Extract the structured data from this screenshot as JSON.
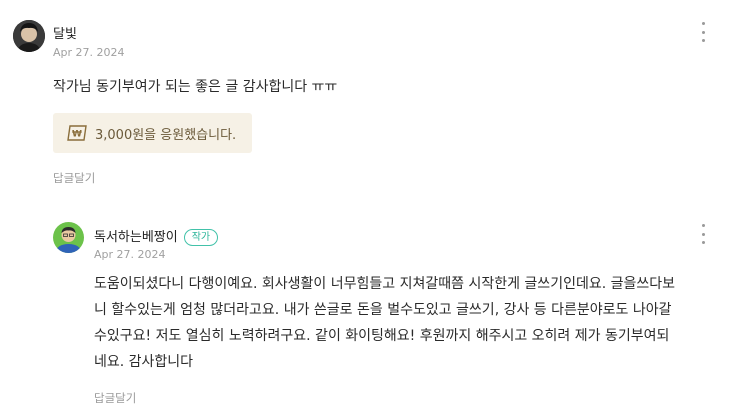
{
  "comment": {
    "username": "달빛",
    "date": "Apr 27. 2024",
    "text": "작가님 동기부여가 되는 좋은 글 감사합니다 ㅠㅠ",
    "support_message": "3,000원을 응원했습니다.",
    "reply_label": "답글달기",
    "more_icon": "kebab-menu-icon"
  },
  "reply": {
    "username": "독서하는베짱이",
    "author_badge": "작가",
    "date": "Apr 27. 2024",
    "lines": [
      "도움이되셨다니 다행이예요. 회사생활이 너무힘들고 지쳐갈때쯤 시작한게 글쓰기인데요. 글을쓰다보",
      "니 할수있는게 엄청 많더라고요. 내가 쓴글로 돈을 벌수도있고 글쓰기, 강사 등 다른분야로도 나아갈",
      "수있구요! 저도 열심히 노력하려구요. 같이 화이팅해요! 후원까지 해주시고 오히려 제가 동기부여되",
      "네요. 감사합니다"
    ],
    "reply_label": "답글달기",
    "more_icon": "kebab-menu-icon"
  },
  "colors": {
    "support_bg": "#f6f1e6",
    "badge_green": "#42c2a9",
    "muted_text": "#a0a0a0"
  }
}
